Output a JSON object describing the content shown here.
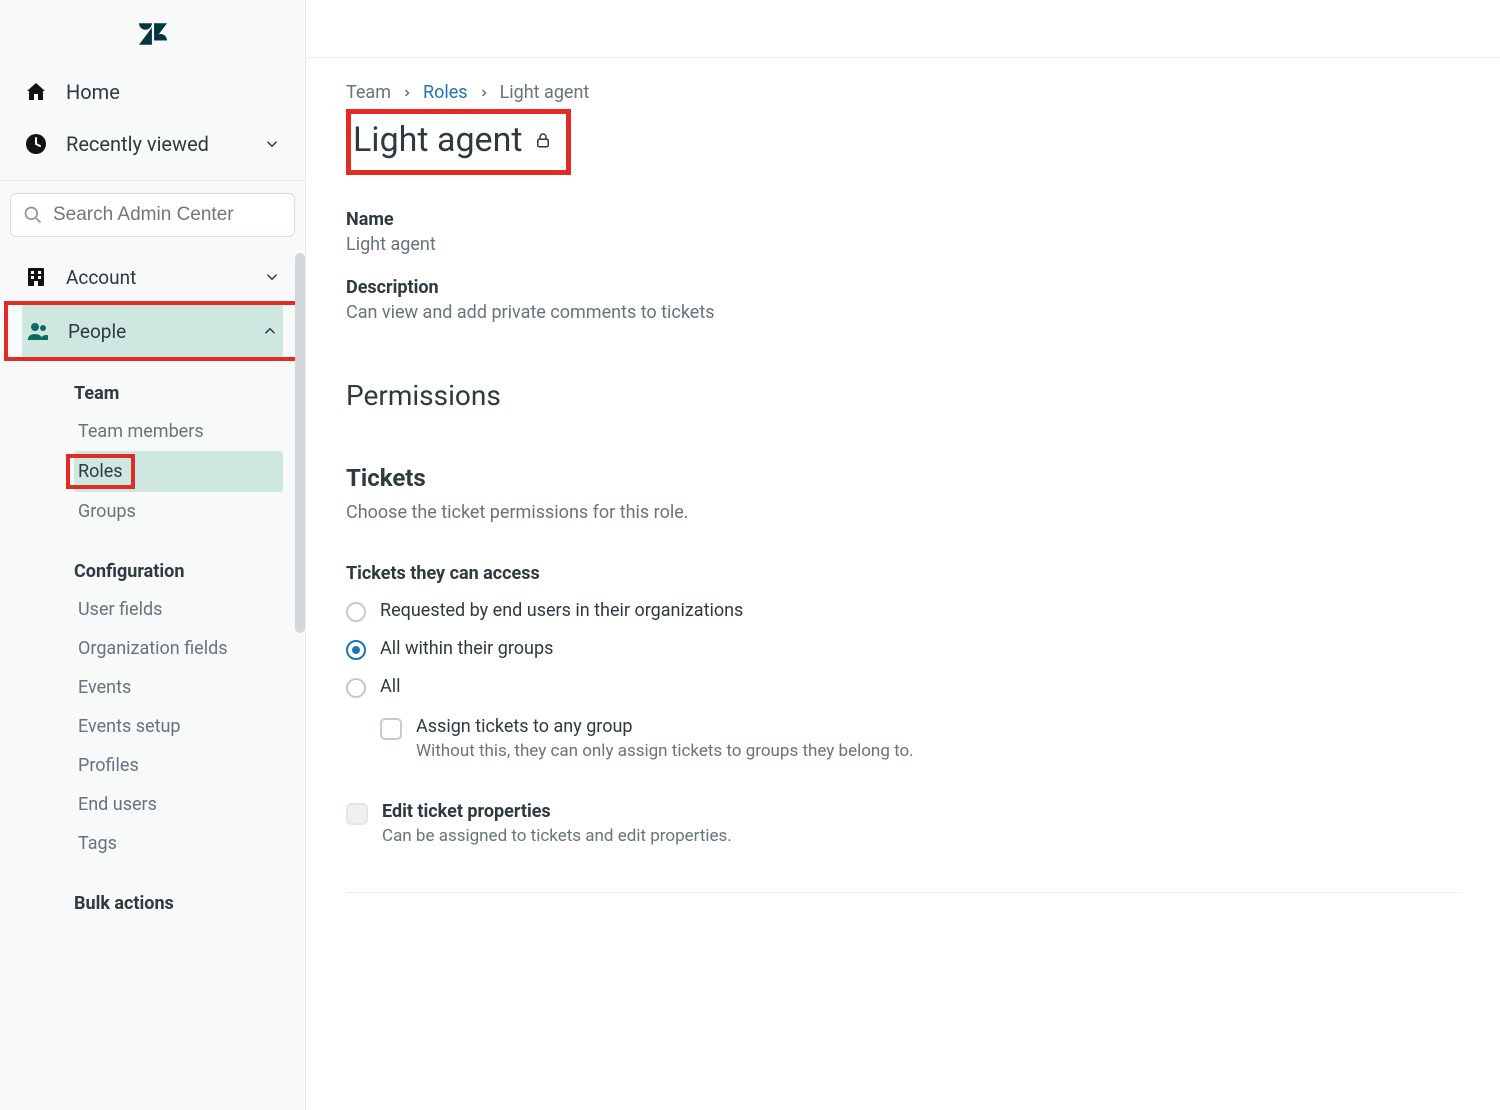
{
  "sidebar": {
    "home": "Home",
    "recently_viewed": "Recently viewed",
    "search_placeholder": "Search Admin Center",
    "account": "Account",
    "people": "People",
    "sub": {
      "team_heading": "Team",
      "team_members": "Team members",
      "roles": "Roles",
      "groups": "Groups",
      "config_heading": "Configuration",
      "user_fields": "User fields",
      "org_fields": "Organization fields",
      "events": "Events",
      "events_setup": "Events setup",
      "profiles": "Profiles",
      "end_users": "End users",
      "tags": "Tags",
      "bulk_heading": "Bulk actions"
    }
  },
  "breadcrumb": {
    "team": "Team",
    "roles": "Roles",
    "current": "Light agent"
  },
  "title": "Light agent",
  "meta": {
    "name_label": "Name",
    "name_value": "Light agent",
    "desc_label": "Description",
    "desc_value": "Can view and add private comments to tickets"
  },
  "permissions": {
    "heading": "Permissions",
    "tickets_heading": "Tickets",
    "tickets_hint": "Choose the ticket permissions for this role.",
    "access_label": "Tickets they can access",
    "opt1": "Requested by end users in their organizations",
    "opt2": "All within their groups",
    "opt3": "All",
    "assign_label": "Assign tickets to any group",
    "assign_hint": "Without this, they can only assign tickets to groups they belong to.",
    "edit_label": "Edit ticket properties",
    "edit_hint": "Can be assigned to tickets and edit properties."
  }
}
